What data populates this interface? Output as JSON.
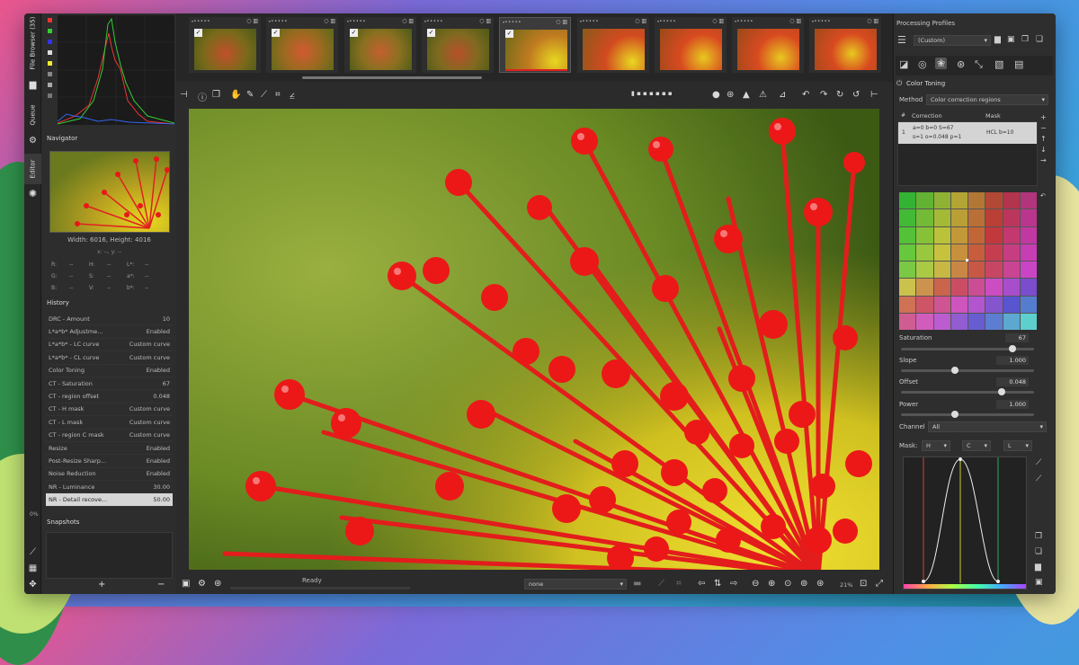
{
  "left_tabs": [
    "File Browser (35)",
    "Queue",
    "Editor"
  ],
  "navigator": {
    "title": "Navigator",
    "dims": "Width: 6016, Height: 4016",
    "coords": "x: --, y: --",
    "rows": [
      [
        "R:",
        "--",
        "H:",
        "--",
        "L*:",
        "--"
      ],
      [
        "G:",
        "--",
        "S:",
        "--",
        "a*:",
        "--"
      ],
      [
        "B:",
        "--",
        "V:",
        "--",
        "b*:",
        "--"
      ]
    ]
  },
  "history": {
    "title": "History",
    "items": [
      {
        "label": "DRC - Amount",
        "value": "10"
      },
      {
        "label": "L*a*b* Adjustme...",
        "value": "Enabled"
      },
      {
        "label": "L*a*b* - LC curve",
        "value": "Custom curve"
      },
      {
        "label": "L*a*b* - CL curve",
        "value": "Custom curve"
      },
      {
        "label": "Color Toning",
        "value": "Enabled"
      },
      {
        "label": "CT - Saturation",
        "value": "67"
      },
      {
        "label": "CT - region offset",
        "value": "0.048"
      },
      {
        "label": "CT - H mask",
        "value": "Custom curve"
      },
      {
        "label": "CT - L mask",
        "value": "Custom curve"
      },
      {
        "label": "CT - region C mask",
        "value": "Custom curve"
      },
      {
        "label": "Resize",
        "value": "Enabled"
      },
      {
        "label": "Post-Resize Sharp...",
        "value": "Enabled"
      },
      {
        "label": "Noise Reduction",
        "value": "Enabled"
      },
      {
        "label": "NR - Luminance",
        "value": "30.00"
      },
      {
        "label": "NR - Detail recove...",
        "value": "50.00"
      }
    ]
  },
  "snapshots": {
    "title": "Snapshots",
    "add": "+",
    "remove": "−",
    "zoom_pct": "0%"
  },
  "status": {
    "text": "Ready",
    "select": "none",
    "zoom": "21%"
  },
  "right": {
    "profiles_title": "Processing Profiles",
    "profile": "(Custom)",
    "tool_title": "Color Toning",
    "method_label": "Method",
    "method_value": "Color correction regions",
    "table_hash": "#",
    "table_corr": "Correction",
    "table_mask": "Mask",
    "row_num": "1",
    "row_corr1": "a=0 b=0 S=67",
    "row_corr2": "s=1 o=0.048 p=1",
    "row_mask": "HCL b=10",
    "saturation_label": "Saturation",
    "saturation": "67",
    "slope_label": "Slope",
    "slope": "1.000",
    "offset_label": "Offset",
    "offset": "0.048",
    "power_label": "Power",
    "power": "1.000",
    "channel_label": "Channel",
    "channel": "All",
    "mask_label": "Mask:",
    "mask_h": "H",
    "mask_c": "C",
    "mask_l": "L"
  }
}
